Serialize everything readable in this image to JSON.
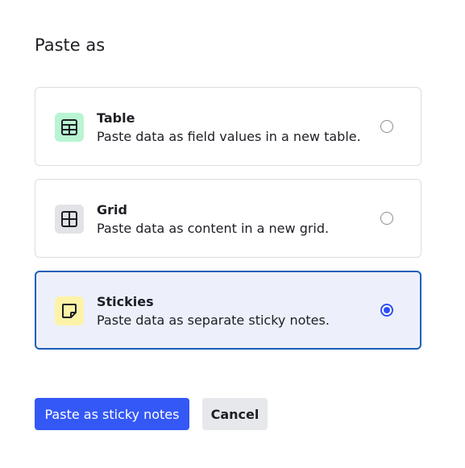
{
  "dialog": {
    "title": "Paste as"
  },
  "options": [
    {
      "label": "Table",
      "description": "Paste data as field values in a new table.",
      "icon": "table-icon",
      "icon_bg": "#b9f5d2",
      "icon_color": "#1e6b3f",
      "selected": false
    },
    {
      "label": "Grid",
      "description": "Paste data as content in a new grid.",
      "icon": "grid-icon",
      "icon_bg": "#e2e3e6",
      "icon_color": "#1d1f25",
      "selected": false
    },
    {
      "label": "Stickies",
      "description": "Paste data as separate sticky notes.",
      "icon": "sticky-note-icon",
      "icon_bg": "#fdf3a8",
      "icon_color": "#1d1f25",
      "selected": true
    }
  ],
  "actions": {
    "primary_label": "Paste as sticky notes",
    "secondary_label": "Cancel"
  },
  "colors": {
    "accent": "#3458f5",
    "selected_border": "#1d5fb8",
    "selected_bg": "#edf0fa"
  }
}
